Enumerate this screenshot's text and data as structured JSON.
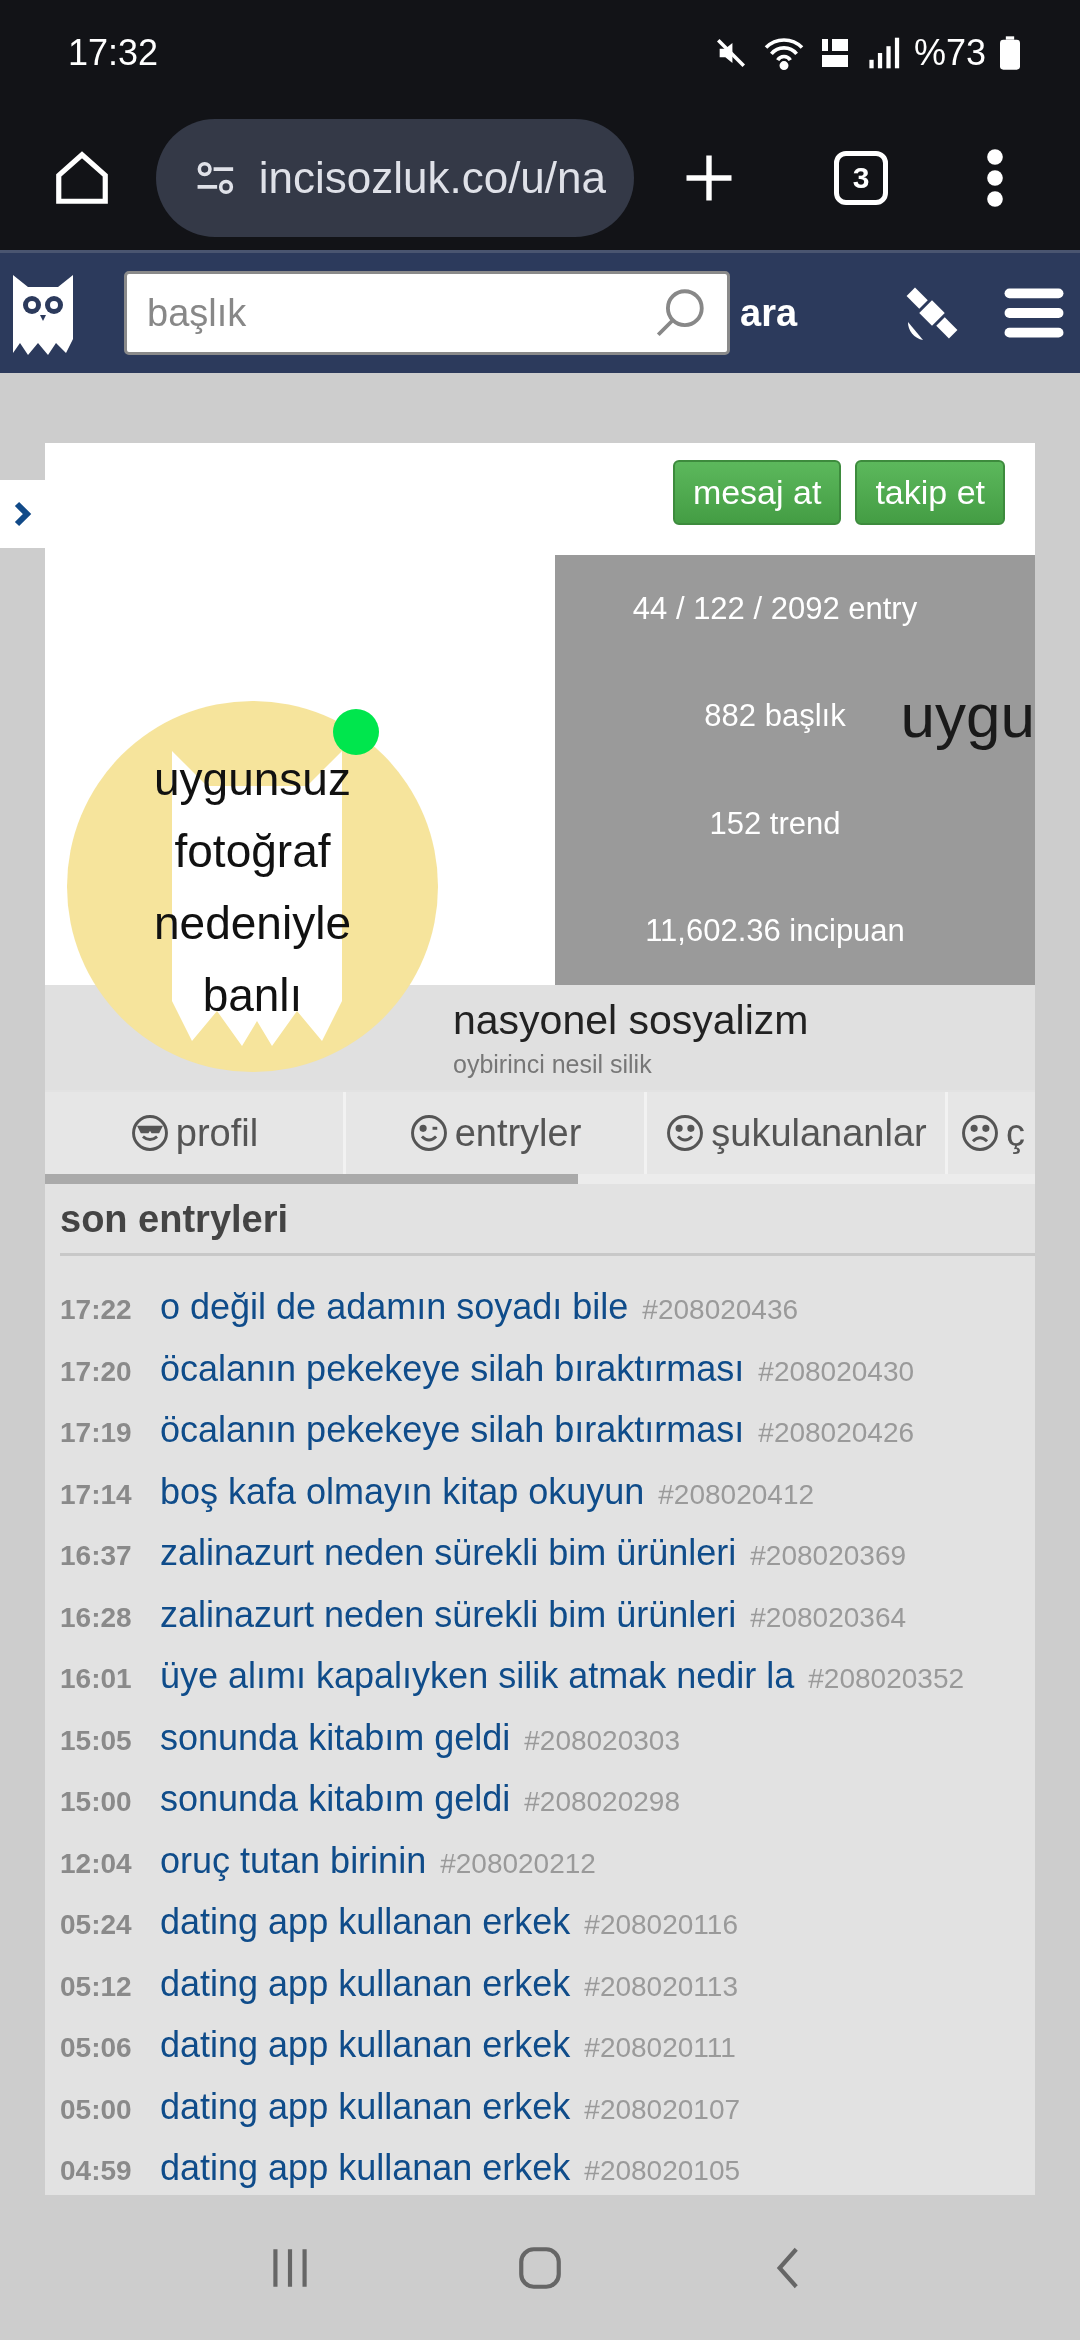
{
  "status_bar": {
    "time": "17:32",
    "battery": "%73"
  },
  "browser": {
    "url": "incisozluk.co/u/na",
    "tab_count": "3"
  },
  "site_header": {
    "search": {
      "placeholder": "başlık"
    },
    "search_button": "ara"
  },
  "profile": {
    "buttons": [
      "mesaj at",
      "takip et"
    ],
    "stats": [
      "44 / 122 / 2092 entry",
      "882 başlık",
      "152 trend",
      "11,602.36 incipuan"
    ],
    "stats_backdrop_text": "uygu",
    "avatar": {
      "text": "uygunsuz fotoğraf nedeniyle banlı",
      "online": true
    },
    "name": "nasyonel sosyalizm",
    "subtitle": "oybirinci nesil silik"
  },
  "tabs": [
    {
      "label": "profil",
      "kind": "cool"
    },
    {
      "label": "entryler",
      "kind": "wink"
    },
    {
      "label": "şukulananlar",
      "kind": "smile"
    },
    {
      "label": "ç",
      "kind": "frown"
    }
  ],
  "section_title": "son entryleri",
  "entries": [
    {
      "time": "17:22",
      "title": "o değil de adamın soyadı bile",
      "id": "#208020436"
    },
    {
      "time": "17:20",
      "title": "öcalanın pekekeye silah bıraktırması",
      "id": "#208020430"
    },
    {
      "time": "17:19",
      "title": "öcalanın pekekeye silah bıraktırması",
      "id": "#208020426"
    },
    {
      "time": "17:14",
      "title": "boş kafa olmayın kitap okuyun",
      "id": "#208020412"
    },
    {
      "time": "16:37",
      "title": "zalinazurt neden sürekli bim ürünleri",
      "id": "#208020369"
    },
    {
      "time": "16:28",
      "title": "zalinazurt neden sürekli bim ürünleri",
      "id": "#208020364"
    },
    {
      "time": "16:01",
      "title": "üye alımı kapalıyken silik atmak nedir la",
      "id": "#208020352"
    },
    {
      "time": "15:05",
      "title": "sonunda kitabım geldi",
      "id": "#208020303"
    },
    {
      "time": "15:00",
      "title": "sonunda kitabım geldi",
      "id": "#208020298"
    },
    {
      "time": "12:04",
      "title": "oruç tutan birinin",
      "id": "#208020212"
    },
    {
      "time": "05:24",
      "title": "dating app kullanan erkek",
      "id": "#208020116"
    },
    {
      "time": "05:12",
      "title": "dating app kullanan erkek",
      "id": "#208020113"
    },
    {
      "time": "05:06",
      "title": "dating app kullanan erkek",
      "id": "#208020111"
    },
    {
      "time": "05:00",
      "title": "dating app kullanan erkek",
      "id": "#208020107"
    },
    {
      "time": "04:59",
      "title": "dating app kullanan erkek",
      "id": "#208020105"
    }
  ]
}
